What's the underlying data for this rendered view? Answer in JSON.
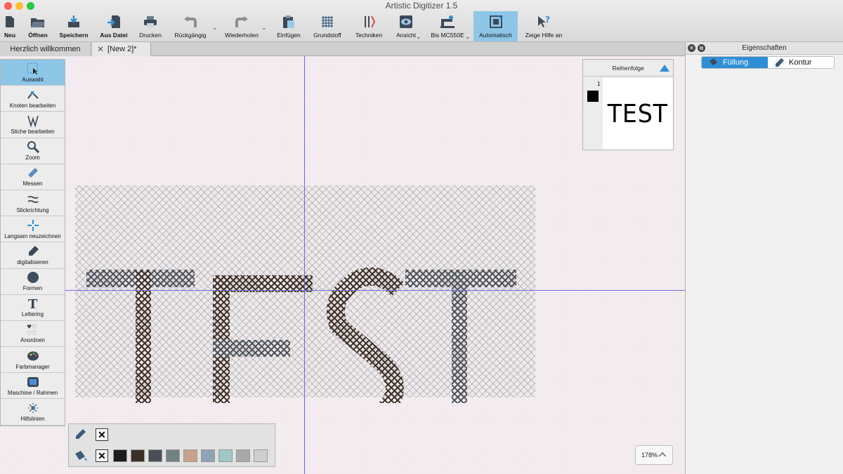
{
  "window": {
    "title": "Artistic Digitizer 1.5"
  },
  "toolbar": {
    "items": [
      {
        "label": "Neu"
      },
      {
        "label": "Öffnen"
      },
      {
        "label": "Speichern"
      },
      {
        "label": "Aus Datei"
      },
      {
        "label": "Drucken"
      },
      {
        "label": "Rückgängig"
      },
      {
        "label": "Wiederholen"
      },
      {
        "label": "Einfügen"
      },
      {
        "label": "Grundstoff"
      },
      {
        "label": "Techniken"
      },
      {
        "label": "Ansicht"
      },
      {
        "label": "Bis MC550E"
      },
      {
        "label": "Automatisch"
      },
      {
        "label": "Zeige Hilfe an"
      }
    ]
  },
  "tabs": [
    {
      "label": "Herzlich willkommen"
    },
    {
      "label": "[New 2]*"
    }
  ],
  "tools": [
    {
      "label": "Auswahl"
    },
    {
      "label": "Knoten bearbeiten"
    },
    {
      "label": "Stiche bearbeiten"
    },
    {
      "label": "Zoom"
    },
    {
      "label": "Messen"
    },
    {
      "label": "Stickrichtung"
    },
    {
      "label": "Langsam neuzeichnen"
    },
    {
      "label": "digitalisieren"
    },
    {
      "label": "Formen"
    },
    {
      "label": "Lettering"
    },
    {
      "label": "Anordnen"
    },
    {
      "label": "Farbmanager"
    },
    {
      "label": "Maschine / Rahmen"
    },
    {
      "label": "Hilfslinien"
    }
  ],
  "sequence": {
    "title": "Reihenfolge",
    "index": "1",
    "thumb_text": "TEST",
    "swatch_color": "#000000"
  },
  "palette": {
    "swatches": [
      "#1c1c1c",
      "#3b3026",
      "#4a4d55",
      "#6f8482",
      "#c9a08c",
      "#8fa3b5",
      "#9fc8c8",
      "#a9a9a9",
      "#cfcfcf"
    ]
  },
  "zoom": {
    "value": "178%"
  },
  "properties": {
    "title": "Eigenschaften",
    "fill_label": "Füllung",
    "outline_label": "Kontur"
  },
  "colors": {
    "accent": "#2f8fd6",
    "active_tool": "#8ec6e8",
    "guide": "#6a6ae0"
  }
}
